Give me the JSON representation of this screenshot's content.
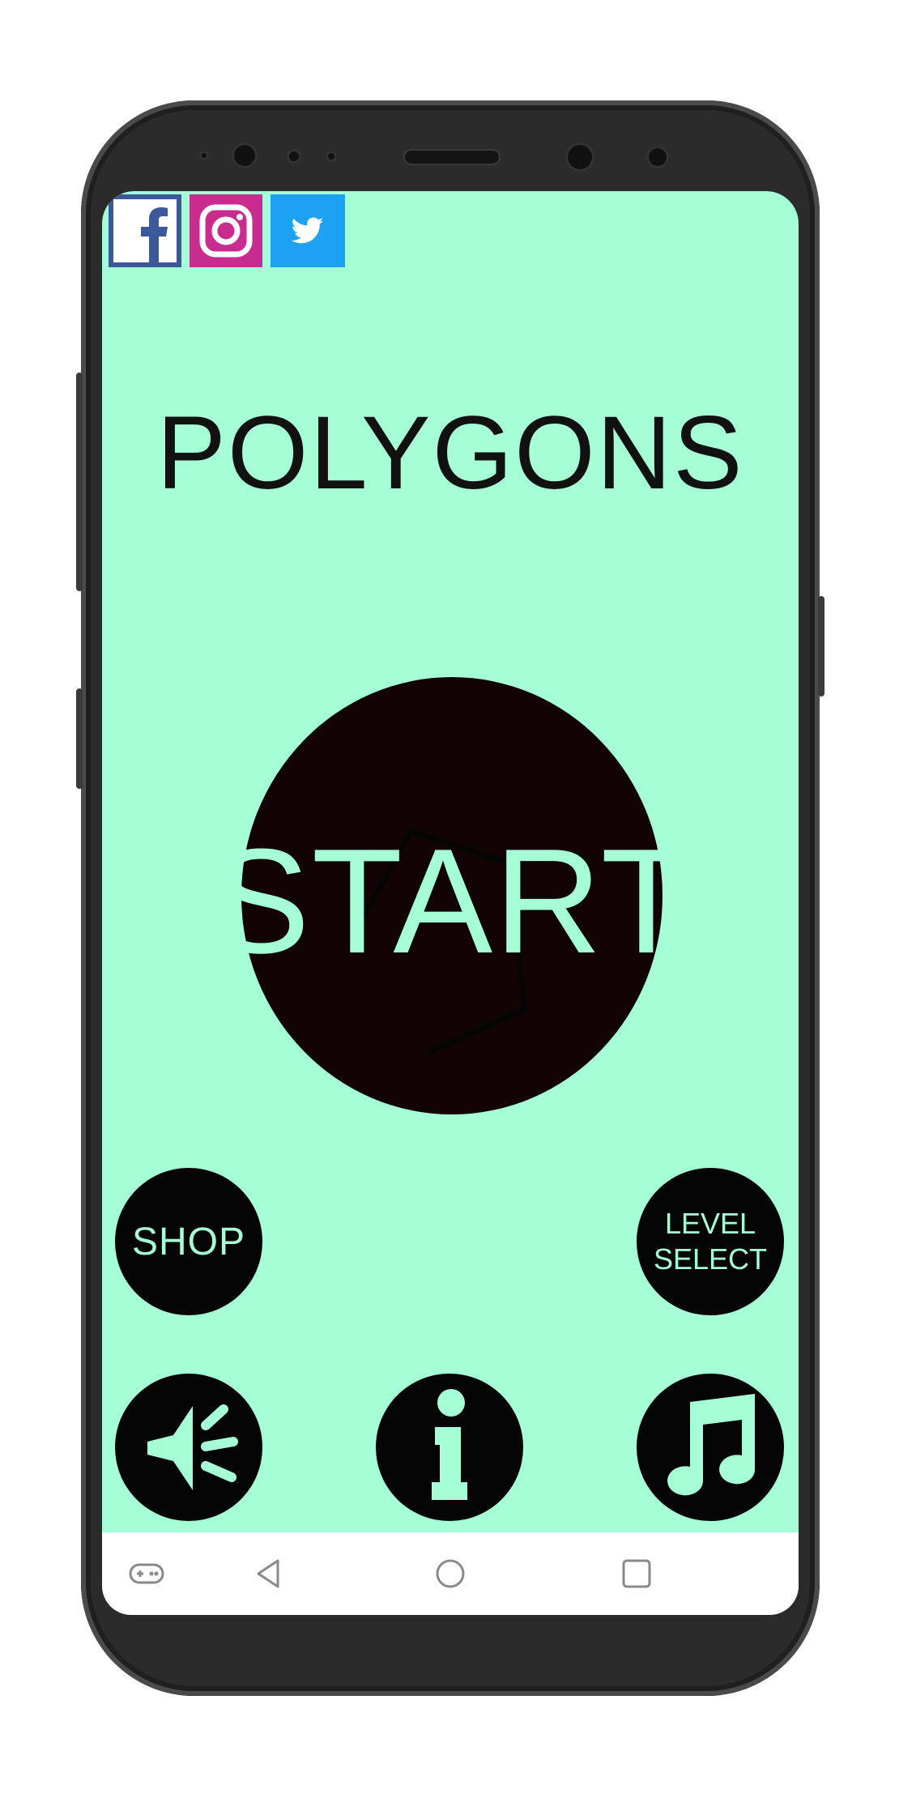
{
  "app": {
    "title": "POLYGONS",
    "start_label": "START",
    "shop_label": "SHOP",
    "level_select_label_line1": "LEVEL",
    "level_select_label_line2": "SELECT"
  },
  "social": {
    "items": [
      "facebook-icon",
      "instagram-icon",
      "twitter-icon"
    ]
  },
  "icons": {
    "sound": "speaker-icon",
    "info": "info-icon",
    "music": "music-note-icon"
  },
  "navbar": {
    "items": [
      "gamepad-icon",
      "back-icon",
      "home-icon",
      "recents-icon"
    ]
  },
  "colors": {
    "background": "#a6fed6",
    "button": "#050505",
    "facebook": "#3b5998",
    "instagram": "#c92c8f",
    "twitter": "#1da1f2"
  }
}
